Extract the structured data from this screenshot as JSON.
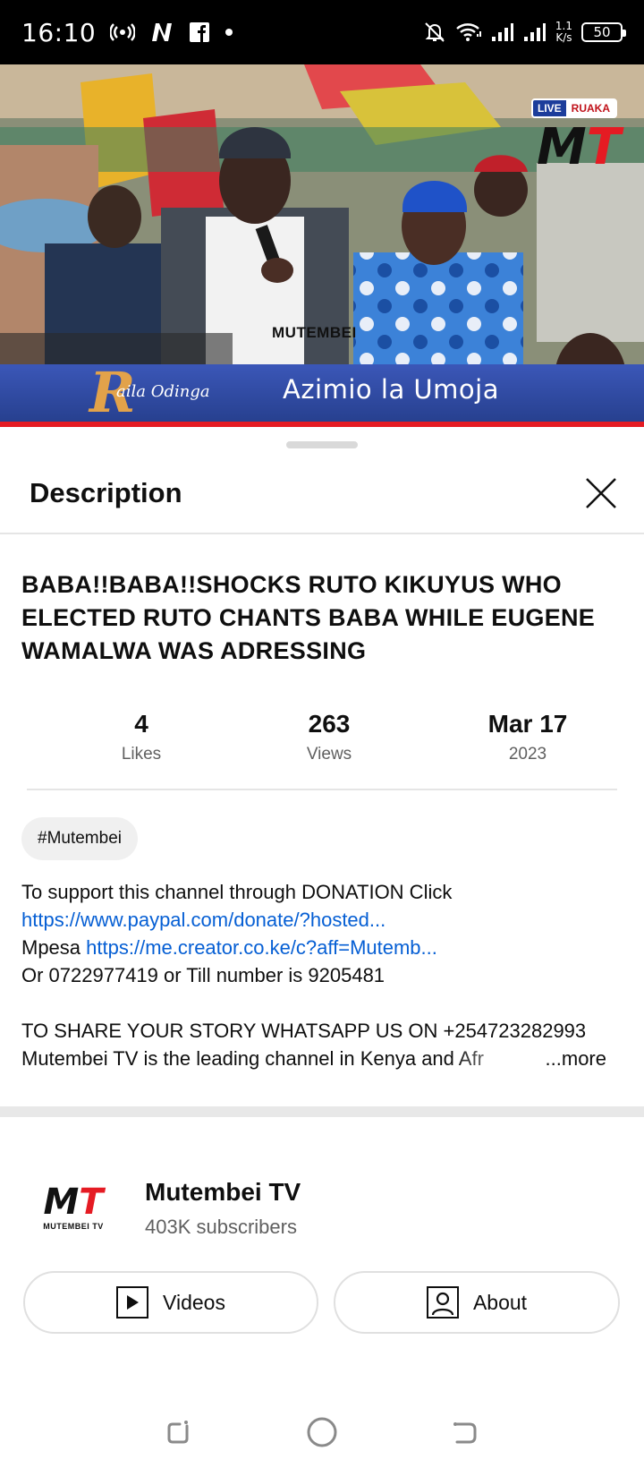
{
  "status_bar": {
    "time": "16:10",
    "net_speed_value": "1.1",
    "net_speed_unit": "K/s",
    "battery": "50",
    "icons": [
      "hotspot-icon",
      "netflix-icon",
      "facebook-icon",
      "dot-icon",
      "mute-bell-icon",
      "wifi-icon",
      "signal-icon",
      "signal-icon-2",
      "battery-icon"
    ]
  },
  "video": {
    "watermark": "MUTEMBEI",
    "lower_third_name": "aila Odinga",
    "lower_third_logo": "R",
    "lower_third_slogan": "Azimio la Umoja",
    "live_label": "LIVE",
    "live_location": "RUAKA",
    "channel_logo": "MT",
    "colors": {
      "lower_third": "#2f4aa6",
      "accent_red": "#e51b23"
    }
  },
  "sheet": {
    "title": "Description",
    "close_icon": "close-icon",
    "video_title": "BABA!!BABA!!SHOCKS RUTO KIKUYUS WHO ELECTED RUTO CHANTS BABA WHILE EUGENE WAMALWA WAS ADRESSING",
    "stats": [
      {
        "value": "4",
        "label": "Likes"
      },
      {
        "value": "263",
        "label": "Views"
      },
      {
        "value": "Mar 17",
        "label": "2023"
      }
    ],
    "hashtag": "#Mutembei",
    "description": {
      "line1": "To support this channel through DONATION Click",
      "link1": "https://www.paypal.com/donate/?hosted...",
      "mpesa_prefix": "Mpesa ",
      "link2": "https://me.creator.co.ke/c?aff=Mutemb...",
      "line4": "Or 0722977419 or Till number is 9205481",
      "line5": "TO SHARE YOUR STORY WHATSAPP US ON +254723282993",
      "line6": "Mutembei TV is the leading channel in Kenya and Afr",
      "more": "...more"
    }
  },
  "channel": {
    "avatar_logo": "MT",
    "avatar_sub": "MUTEMBEI TV",
    "name": "Mutembei TV",
    "subscribers": "403K subscribers",
    "buttons": [
      {
        "label": "Videos",
        "icon": "play-icon"
      },
      {
        "label": "About",
        "icon": "person-icon"
      }
    ]
  },
  "nav": {
    "icons": [
      "recents-icon",
      "home-icon",
      "back-icon"
    ]
  }
}
